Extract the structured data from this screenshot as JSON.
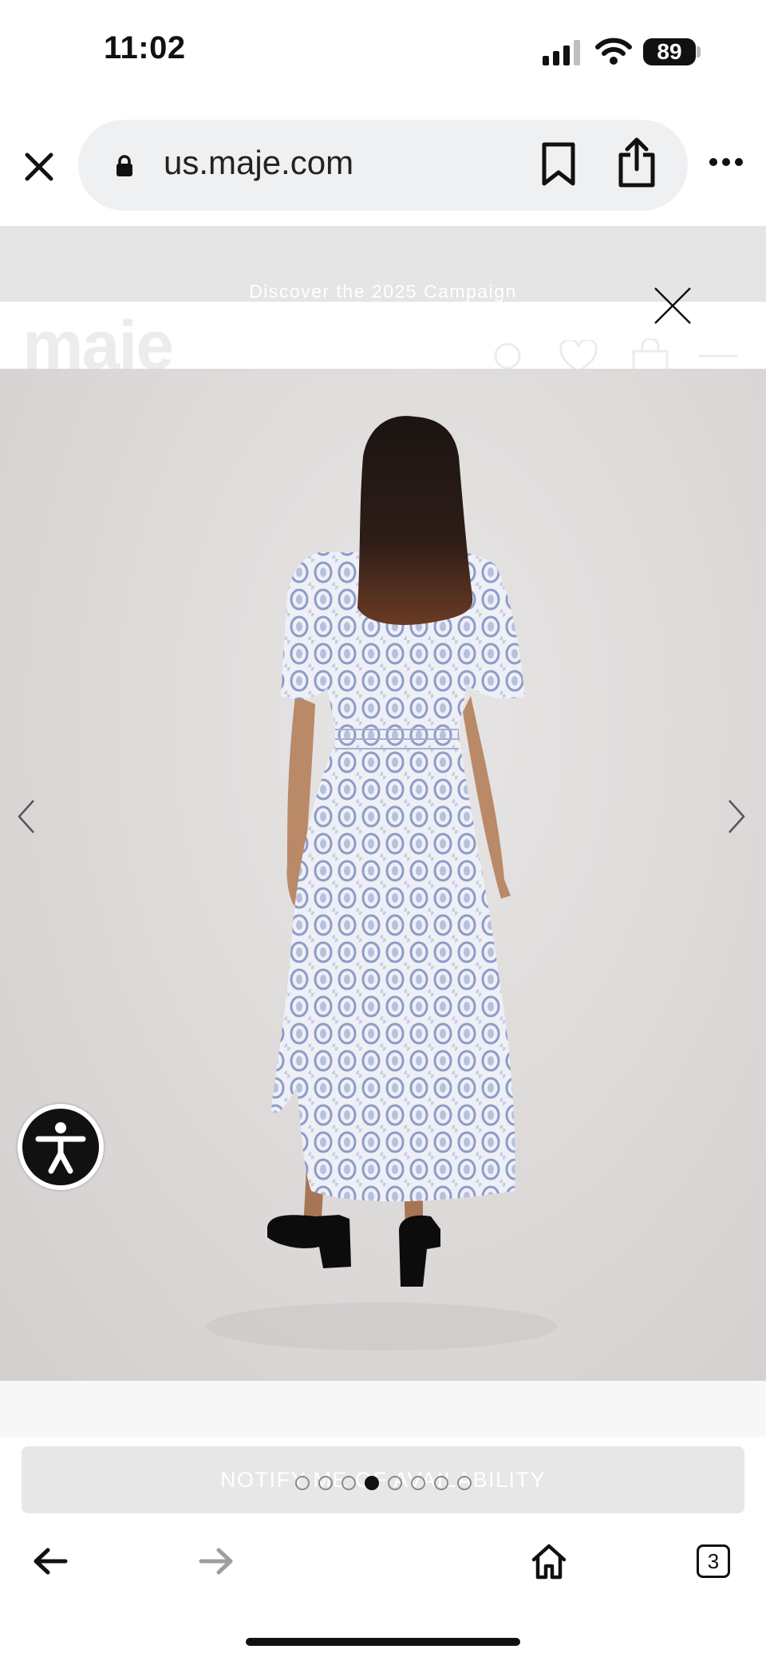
{
  "status_bar": {
    "time": "11:02",
    "battery": "89"
  },
  "browser": {
    "url": "us.maje.com"
  },
  "site": {
    "promo_text": "Discover the 2025 Campaign",
    "logo_text": "maje"
  },
  "gallery": {
    "image_count": 8,
    "active_index": 3,
    "notify_button": "NOTIFY ME OF AVAILABILITY"
  },
  "toolbar": {
    "tab_count": "3"
  },
  "colors": {
    "dress_print": "#8d9cc9",
    "backdrop": "#dcd9d8"
  }
}
